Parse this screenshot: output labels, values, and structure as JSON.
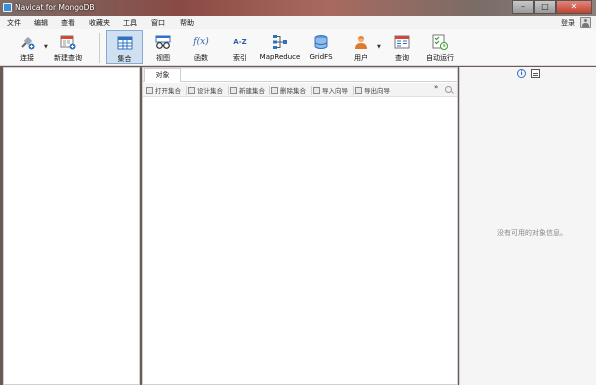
{
  "window": {
    "title": "Navicat for MongoDB",
    "controls": [
      "–",
      "□",
      "✕"
    ]
  },
  "menu": {
    "items": [
      "文件",
      "编辑",
      "查看",
      "收藏夹",
      "工具",
      "窗口",
      "帮助"
    ],
    "login": "登录"
  },
  "toolbar": {
    "items": [
      {
        "label": "连接",
        "icon": "connection-icon"
      },
      {
        "label": "新建查询",
        "icon": "new-query-icon"
      },
      {
        "label": "集合",
        "icon": "collection-icon",
        "active": true
      },
      {
        "label": "视图",
        "icon": "view-icon"
      },
      {
        "label": "函数",
        "icon": "function-icon",
        "glyph": "f(x)"
      },
      {
        "label": "索引",
        "icon": "index-icon",
        "glyph": "A-Z"
      },
      {
        "label": "MapReduce",
        "icon": "mapreduce-icon"
      },
      {
        "label": "GridFS",
        "icon": "gridfs-icon"
      },
      {
        "label": "用户",
        "icon": "user-icon"
      },
      {
        "label": "查询",
        "icon": "query-icon"
      },
      {
        "label": "自动运行",
        "icon": "automation-icon"
      }
    ]
  },
  "center": {
    "tab": "对象",
    "actions": [
      "打开集合",
      "设计集合",
      "新建集合",
      "删除集合",
      "导入向导",
      "导出向导"
    ],
    "more": "»"
  },
  "right": {
    "empty_message": "没有可用的对象信息。"
  },
  "colors": {
    "accent": "#2f72c4",
    "active_tool": "#cfe0f1"
  }
}
